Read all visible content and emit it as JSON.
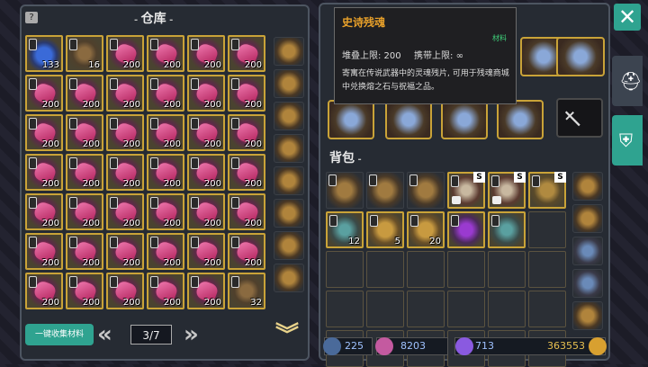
{
  "warehouse": {
    "title": "仓库",
    "collect_label": "一键收集材料",
    "page": "3/7",
    "items": [
      {
        "t": "blue",
        "c": "133"
      },
      {
        "t": "helm",
        "c": "16"
      },
      {
        "t": "epic",
        "c": "200"
      },
      {
        "t": "epic",
        "c": "200"
      },
      {
        "t": "epic",
        "c": "200"
      },
      {
        "t": "epic",
        "c": "200"
      },
      {
        "t": "epic",
        "c": "200"
      },
      {
        "t": "epic",
        "c": "200"
      },
      {
        "t": "epic",
        "c": "200"
      },
      {
        "t": "epic",
        "c": "200"
      },
      {
        "t": "epic",
        "c": "200"
      },
      {
        "t": "epic",
        "c": "200"
      },
      {
        "t": "epic",
        "c": "200"
      },
      {
        "t": "epic",
        "c": "200"
      },
      {
        "t": "epic",
        "c": "200"
      },
      {
        "t": "epic",
        "c": "200"
      },
      {
        "t": "epic",
        "c": "200"
      },
      {
        "t": "epic",
        "c": "200"
      },
      {
        "t": "epic",
        "c": "200"
      },
      {
        "t": "epic",
        "c": "200"
      },
      {
        "t": "epic",
        "c": "200"
      },
      {
        "t": "epic",
        "c": "200"
      },
      {
        "t": "epic",
        "c": "200"
      },
      {
        "t": "epic",
        "c": "200"
      },
      {
        "t": "epic",
        "c": "200"
      },
      {
        "t": "epic",
        "c": "200"
      },
      {
        "t": "epic",
        "c": "200"
      },
      {
        "t": "epic",
        "c": "200"
      },
      {
        "t": "epic",
        "c": "200"
      },
      {
        "t": "epic",
        "c": "200"
      },
      {
        "t": "epic",
        "c": "200"
      },
      {
        "t": "epic",
        "c": "200"
      },
      {
        "t": "epic",
        "c": "200"
      },
      {
        "t": "epic",
        "c": "200"
      },
      {
        "t": "epic",
        "c": "200"
      },
      {
        "t": "epic",
        "c": "200"
      },
      {
        "t": "epic",
        "c": "200"
      },
      {
        "t": "epic",
        "c": "200"
      },
      {
        "t": "epic",
        "c": "200"
      },
      {
        "t": "epic",
        "c": "200"
      },
      {
        "t": "epic",
        "c": "200"
      },
      {
        "t": "helm",
        "c": "32"
      }
    ]
  },
  "tooltip": {
    "name": "史诗残魂",
    "category": "材料",
    "stack": "堆叠上限: 200",
    "carry": "携带上限: ∞",
    "desc": "寄寓在传说武器中的灵魂残片, 可用于残魂商城中兑换熔之石与祝福之品。"
  },
  "backpack": {
    "title": "背包",
    "row1": [
      {
        "t": "bag",
        "c": ""
      },
      {
        "t": "bag",
        "c": ""
      },
      {
        "t": "bag",
        "c": ""
      },
      {
        "t": "lock",
        "c": "",
        "badge": "S"
      },
      {
        "t": "lock",
        "c": "",
        "badge": "S"
      },
      {
        "t": "bagg",
        "c": "",
        "badge": "S"
      }
    ],
    "row2": [
      {
        "t": "tool",
        "c": "12"
      },
      {
        "t": "book",
        "c": "5"
      },
      {
        "t": "book",
        "c": "20"
      },
      {
        "t": "potion",
        "c": ""
      },
      {
        "t": "tool",
        "c": ""
      }
    ]
  },
  "currency": {
    "c1": "225",
    "c2": "8203",
    "c3": "713",
    "gold": "363553"
  },
  "colors": {
    "accent": "#2fa390",
    "gold_border": "#c9a338",
    "tooltip_title": "#e8a02a",
    "tooltip_cat": "#3fd07a"
  }
}
